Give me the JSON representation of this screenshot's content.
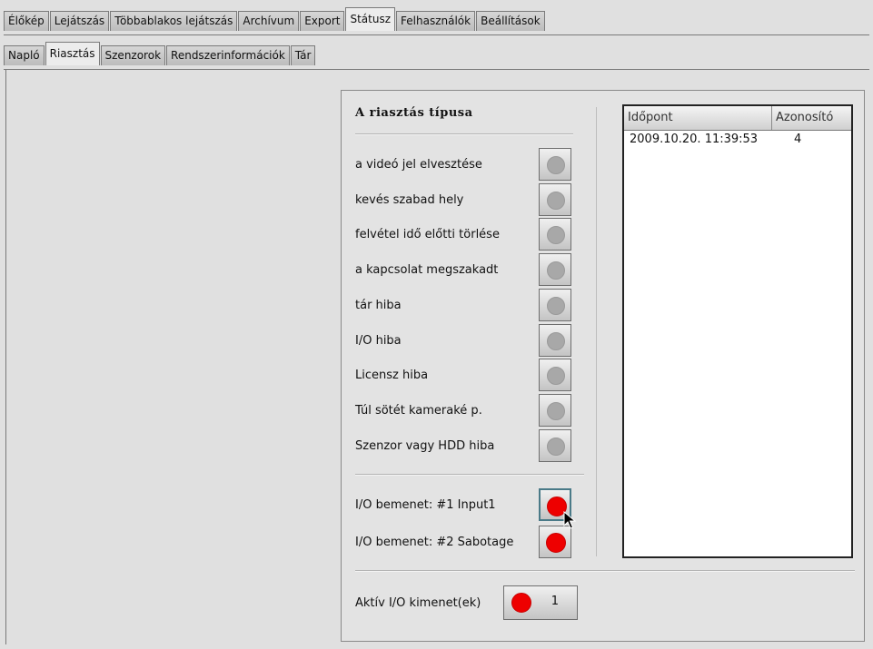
{
  "main_tabs": [
    "Élőkép",
    "Lejátszás",
    "Többablakos lejátszás",
    "Archívum",
    "Export",
    "Státusz",
    "Felhasználók",
    "Beállítások"
  ],
  "active_main_tab": "Státusz",
  "sub_tabs": [
    "Napló",
    "Riasztás",
    "Szenzorok",
    "Rendszerinformációk",
    "Tár"
  ],
  "active_sub_tab": "Riasztás",
  "alarm_panel": {
    "title": "A riasztás típusa",
    "alarm_types": [
      {
        "label": "a videó jel elvesztése",
        "state": "inactive"
      },
      {
        "label": "kevés szabad hely",
        "state": "inactive"
      },
      {
        "label": "felvétel idő előtti törlése",
        "state": "inactive"
      },
      {
        "label": "a kapcsolat megszakadt",
        "state": "inactive"
      },
      {
        "label": "tár hiba",
        "state": "inactive"
      },
      {
        "label": "I/O hiba",
        "state": "inactive"
      },
      {
        "label": "Licensz hiba",
        "state": "inactive"
      },
      {
        "label": "Túl sötét kameraké p.",
        "state": "inactive"
      },
      {
        "label": "Szenzor vagy HDD hiba",
        "state": "inactive"
      }
    ],
    "io_inputs": [
      {
        "label": "I/O bemenet: #1 Input1",
        "state": "active"
      },
      {
        "label": "I/O bemenet: #2 Sabotage",
        "state": "active"
      }
    ],
    "output": {
      "label": "Aktív I/O kimenet(ek)",
      "value": "1"
    }
  },
  "event_table": {
    "columns": [
      "Időpont",
      "Azonosító"
    ],
    "rows": [
      [
        "2009.10.20. 11:39:53",
        "4"
      ]
    ]
  },
  "colors": {
    "active_indicator": "#ee0000",
    "inactive_indicator": "#a8a8a8",
    "background": "#e0e0e0"
  }
}
